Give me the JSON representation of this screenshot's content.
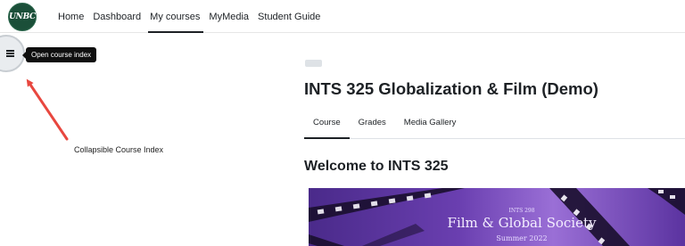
{
  "logo": {
    "text": "UNBC"
  },
  "nav": {
    "items": [
      {
        "label": "Home"
      },
      {
        "label": "Dashboard"
      },
      {
        "label": "My courses",
        "active": true
      },
      {
        "label": "MyMedia"
      },
      {
        "label": "Student Guide"
      }
    ]
  },
  "drawer": {
    "icon": "list-icon",
    "tooltip": "Open course index"
  },
  "annotation": {
    "text": "Collapsible Course Index",
    "arrow_color": "#e8473f"
  },
  "course": {
    "title": "INTS 325 Globalization & Film (Demo)",
    "tabs": [
      {
        "label": "Course",
        "active": true
      },
      {
        "label": "Grades"
      },
      {
        "label": "Media Gallery"
      }
    ],
    "welcome": "Welcome to INTS 325"
  },
  "banner": {
    "line1": "INTS 298",
    "line2": "Film & Global Society",
    "line3": "Summer 2022"
  },
  "colors": {
    "brand": "#1b4f39",
    "text": "#1d2125",
    "tooltip_bg": "#0f0f0f",
    "banner_purple": "#6a3fb0"
  }
}
